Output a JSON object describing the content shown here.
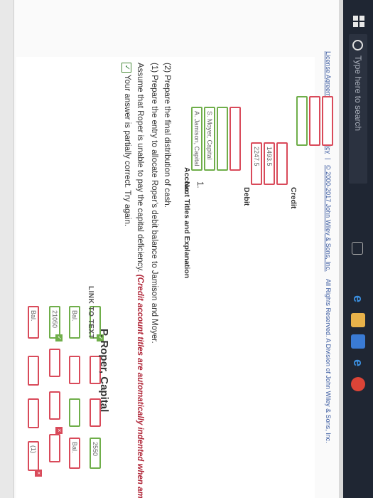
{
  "taskbar": {
    "search_placeholder": "Type here to search"
  },
  "footer": {
    "license": "License Agreement",
    "sep1": "|",
    "privacy": "Privacy Policy",
    "sep2": "|",
    "copyright": "© 2000-2017 John Wiley & Sons, Inc.",
    "rights": "All Rights Reserved. A Division of John Wiley & Sons, Inc."
  },
  "account": {
    "title": "P. Roper, Capital",
    "link_text": "LINK TO TEXT"
  },
  "t_account": {
    "left_label": "(1)",
    "bal_left": "Bal.",
    "bal_right_top": "Bal.",
    "amount_right_top": "2550",
    "amount_left_bal": "21050",
    "bal_left_bottom": "Bal."
  },
  "feedback": {
    "text": "Your answer is partially correct.  Try again."
  },
  "problem": {
    "line1_plain": "Assume that Roper is unable to pay the capital deficiency.",
    "line1_red": "(Credit account titles are automatically indented when amount",
    "line2": "(1)  Prepare the entry to allocate Roper's debit balance to Jamison and Moyer.",
    "line3": "(2)  Prepare the final distribution of cash."
  },
  "journal": {
    "headers": {
      "no": "No.",
      "titles": "Account Titles and Explanation",
      "debit": "Debit",
      "credit": "Credit"
    },
    "row_no": "1.",
    "rows": [
      {
        "title": "A. Jamison, Capital",
        "debit": "2247.5"
      },
      {
        "title": "S. Moyer, Capital",
        "debit": "1493.5"
      }
    ]
  }
}
